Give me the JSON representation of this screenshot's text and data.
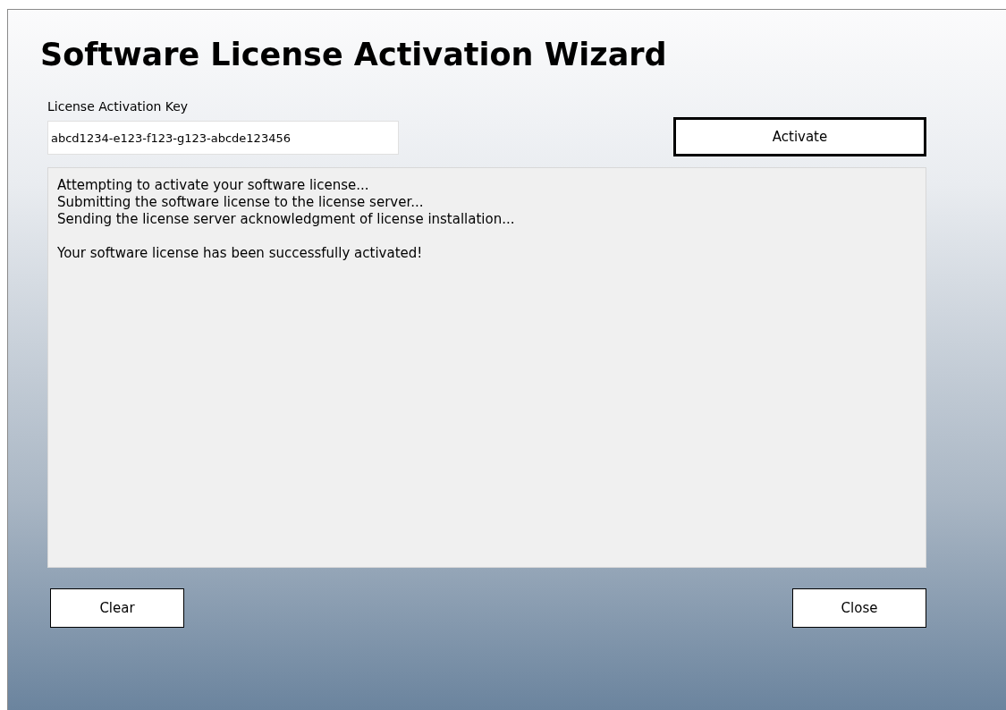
{
  "window": {
    "title": "Software License Activation Wizard"
  },
  "key_field": {
    "label": "License Activation Key",
    "value": "abcd1234-e123-f123-g123-abcde123456"
  },
  "activate_button": {
    "label": "Activate",
    "focused": true
  },
  "log": {
    "lines": [
      "Attempting to activate your software license...",
      "Submitting the software license to the license server...",
      "Sending the license server acknowledgment of license installation..."
    ],
    "result": "Your software license has been successfully activated!"
  },
  "clear_button": {
    "label": "Clear"
  },
  "close_button": {
    "label": "Close"
  }
}
